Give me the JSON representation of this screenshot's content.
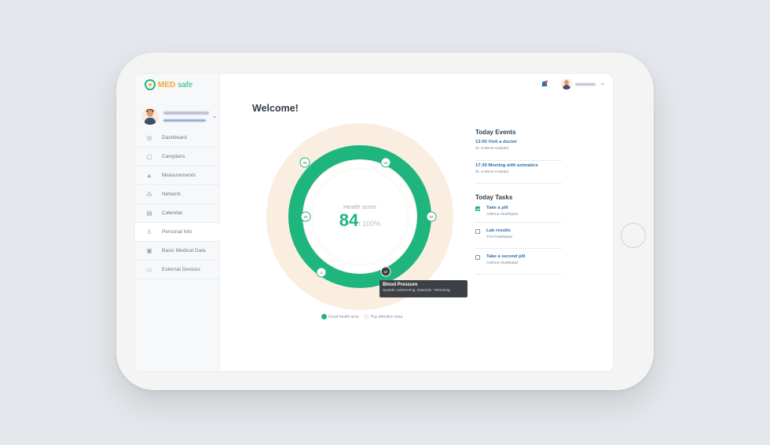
{
  "app": {
    "logo_med": "MED",
    "logo_safe": "safe"
  },
  "sidebar": {
    "items": [
      {
        "label": "Dashboard",
        "icon": "dashboard-icon"
      },
      {
        "label": "Careplans",
        "icon": "document-icon"
      },
      {
        "label": "Measurements",
        "icon": "flask-icon"
      },
      {
        "label": "Network",
        "icon": "network-icon"
      },
      {
        "label": "Calendar",
        "icon": "calendar-icon"
      },
      {
        "label": "Personal Info",
        "icon": "person-icon",
        "active": true
      },
      {
        "label": "Basic Medical Data",
        "icon": "clipboard-icon"
      },
      {
        "label": "External Devices",
        "icon": "devices-icon"
      }
    ]
  },
  "main": {
    "welcome": "Welcome!",
    "score": {
      "label": "Health score",
      "value": "84",
      "max": "/ 100%"
    },
    "markers": [
      "HR",
      "O2",
      "RT",
      "BP",
      "G",
      "PH"
    ],
    "tooltip": {
      "title": "Blood Pressure",
      "body": "Systolic:120mm/Hg, Diastolic: 79mm/Hg"
    },
    "legend": [
      {
        "label": "Good health area",
        "color": "#1fb57f"
      },
      {
        "label": "Pay attention area",
        "color": "#faeee1"
      }
    ]
  },
  "events": {
    "title": "Today Events",
    "items": [
      {
        "title": "13:00 Visit a doctor",
        "subtitle": "St. Andrew Hospital"
      },
      {
        "title": "17:30 Meeting with astmatics",
        "subtitle": "St. Andrew Hospital"
      }
    ]
  },
  "tasks": {
    "title": "Today Tasks",
    "items": [
      {
        "title": "Take a pill",
        "subtitle": "Asthma Healthplan",
        "checked": true
      },
      {
        "title": "Lab results",
        "subtitle": "TAVI healthplan",
        "checked": false
      },
      {
        "title": "Take a second pill",
        "subtitle": "Asthma Healthplan",
        "checked": false
      }
    ]
  },
  "colors": {
    "accent": "#1fb57f",
    "brand_orange": "#f3a93a",
    "link": "#2d6fa8"
  }
}
